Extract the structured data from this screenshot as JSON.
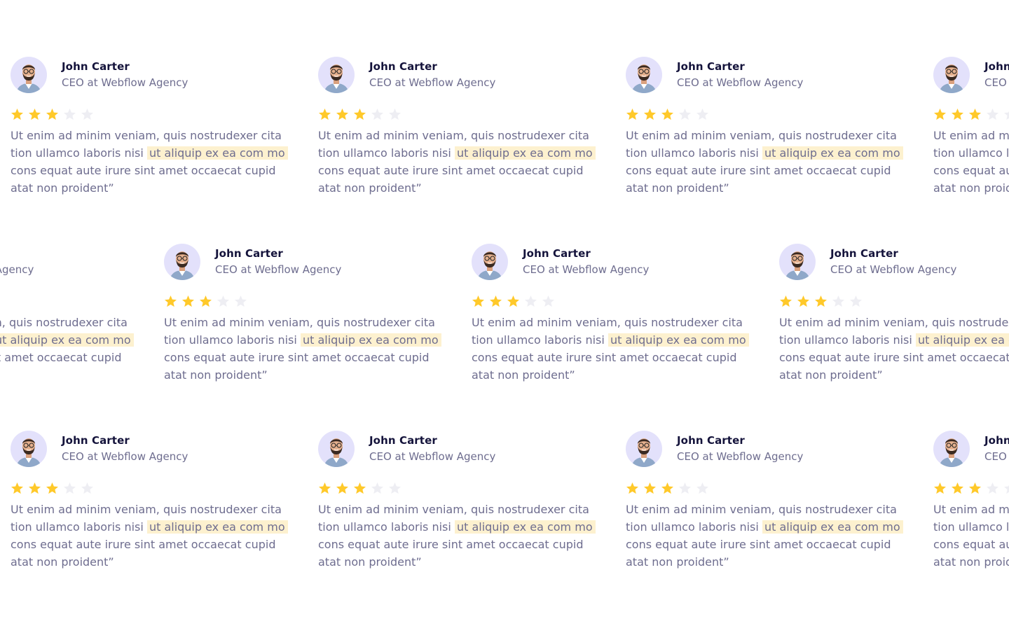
{
  "testimonial": {
    "name": "John Carter",
    "role": "CEO at Webflow Agency",
    "rating": 3,
    "rating_max": 5,
    "quote": {
      "line1": "Ut enim ad minim veniam, quis nostrudexer cita",
      "line2_prefix": "tion ullamco laboris nisi",
      "line2_highlight": "ut aliquip ex ea com mo",
      "line3": "cons equat aute irure sint amet occaecat cupid",
      "line4": "atat non proident”"
    },
    "avatar_icon": "person-avatar-icon",
    "star_icon": "star-icon"
  },
  "colors": {
    "star_filled": "#ffc92a",
    "star_empty": "#eeeef3",
    "highlight_bg": "#fdf1cf",
    "name": "#14133b",
    "body_text": "#6e6d8f",
    "avatar_bg": "#e3e1fb"
  }
}
